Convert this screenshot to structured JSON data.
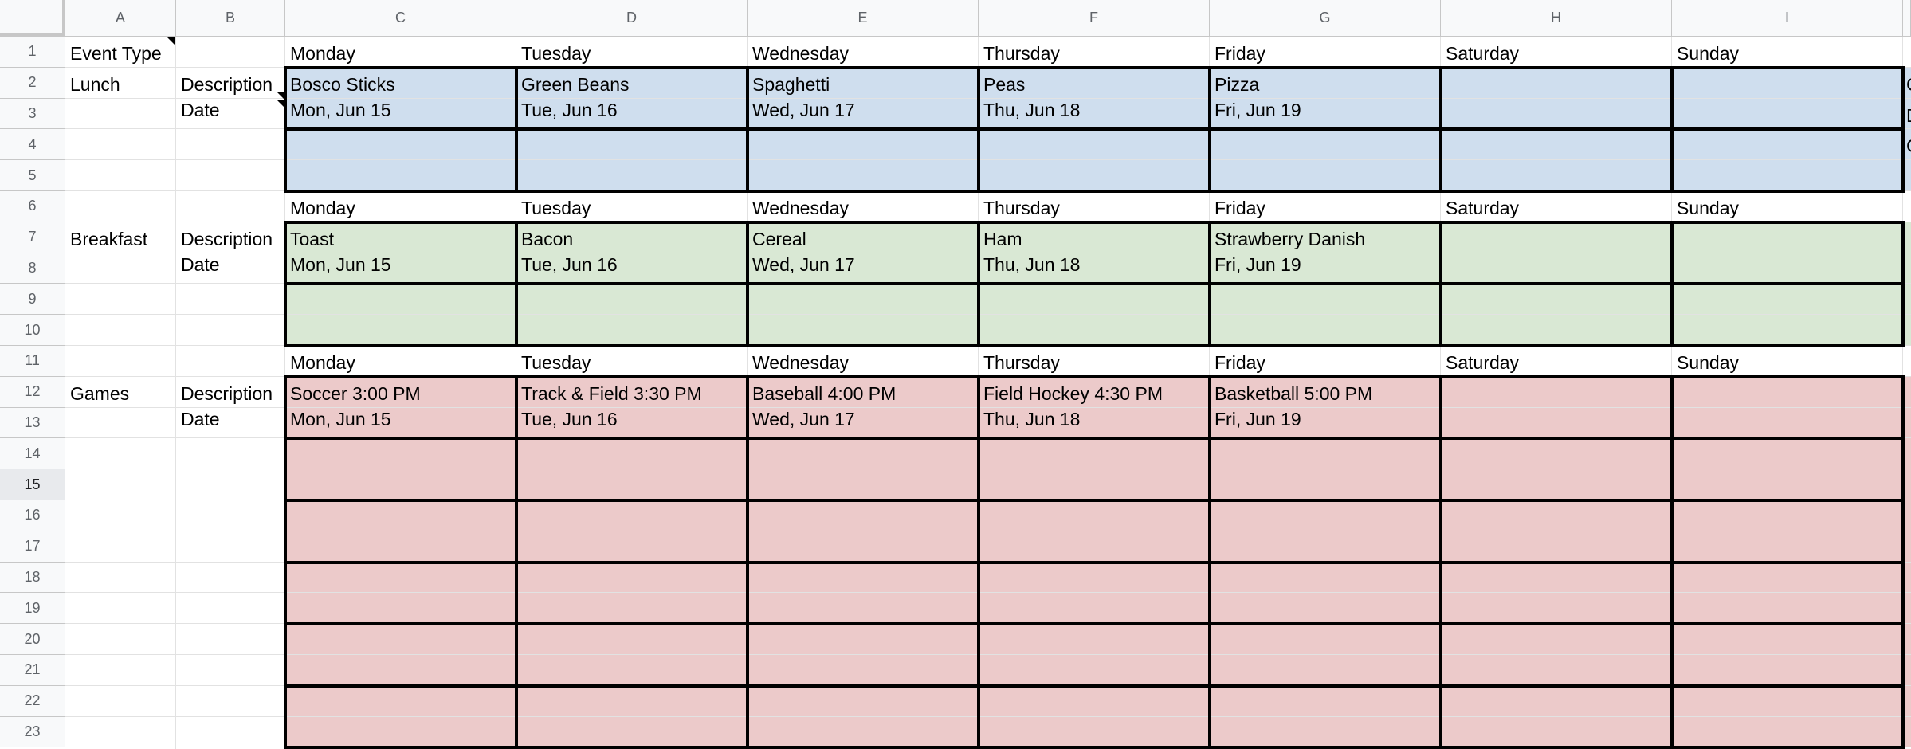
{
  "columns": [
    "A",
    "B",
    "C",
    "D",
    "E",
    "F",
    "G",
    "H",
    "I"
  ],
  "rows": [
    "1",
    "2",
    "3",
    "4",
    "5",
    "6",
    "7",
    "8",
    "9",
    "10",
    "11",
    "12",
    "13",
    "14",
    "15",
    "16",
    "17",
    "18",
    "19",
    "20",
    "21",
    "22",
    "23"
  ],
  "selected_row": "15",
  "colors": {
    "lunch": "#cfdeee",
    "breakfast": "#d9e8d4",
    "games": "#eccaca",
    "header_bg": "#f8f9fa"
  },
  "header_label": "Event Type",
  "sections": [
    {
      "event_type": "Lunch",
      "day_headers": [
        "Monday",
        "Tuesday",
        "Wednesday",
        "Thursday",
        "Friday",
        "Saturday",
        "Sunday"
      ],
      "field_labels": [
        "Description",
        "Date"
      ],
      "descriptions": [
        "Bosco Sticks",
        "Green Beans",
        "Spaghetti",
        "Peas",
        "Pizza",
        "",
        ""
      ],
      "dates": [
        "Mon, Jun 15",
        "Tue, Jun 16",
        "Wed, Jun 17",
        "Thu, Jun 18",
        "Fri, Jun 19",
        "",
        ""
      ],
      "overflow": [
        "C",
        "D",
        "C"
      ]
    },
    {
      "event_type": "Breakfast",
      "day_headers": [
        "Monday",
        "Tuesday",
        "Wednesday",
        "Thursday",
        "Friday",
        "Saturday",
        "Sunday"
      ],
      "field_labels": [
        "Description",
        "Date"
      ],
      "descriptions": [
        "Toast",
        "Bacon",
        "Cereal",
        "Ham",
        "Strawberry Danish",
        "",
        ""
      ],
      "dates": [
        "Mon, Jun 15",
        "Tue, Jun 16",
        "Wed, Jun 17",
        "Thu, Jun 18",
        "Fri, Jun 19",
        "",
        ""
      ]
    },
    {
      "event_type": "Games",
      "day_headers": [
        "Monday",
        "Tuesday",
        "Wednesday",
        "Thursday",
        "Friday",
        "Saturday",
        "Sunday"
      ],
      "field_labels": [
        "Description",
        "Date"
      ],
      "descriptions": [
        "Soccer 3:00 PM",
        "Track & Field 3:30 PM",
        "Baseball 4:00 PM",
        "Field Hockey 4:30 PM",
        "Basketball 5:00 PM",
        "",
        ""
      ],
      "dates": [
        "Mon, Jun 15",
        "Tue, Jun 16",
        "Wed, Jun 17",
        "Thu, Jun 18",
        "Fri, Jun 19",
        "",
        ""
      ]
    }
  ]
}
